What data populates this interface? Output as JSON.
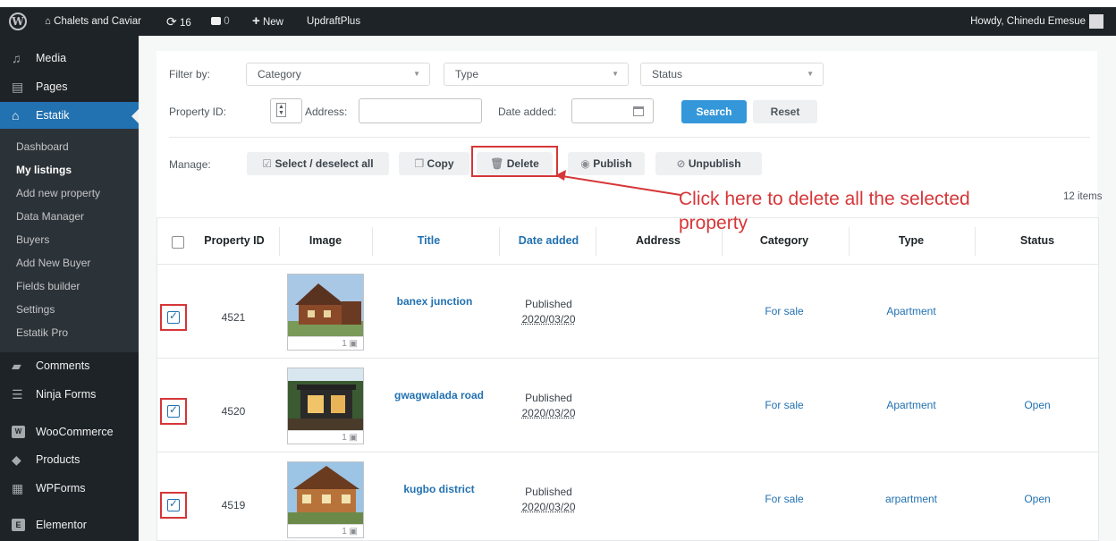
{
  "admin_bar": {
    "site_name": "Chalets and Caviar",
    "updates_count": "16",
    "comments_count": "0",
    "new_label": "New",
    "plugin_label": "UpdraftPlus",
    "howdy": "Howdy, Chinedu Emesue"
  },
  "sidebar": {
    "media": "Media",
    "pages": "Pages",
    "estatik": "Estatik",
    "submenu": [
      "Dashboard",
      "My listings",
      "Add new property",
      "Data Manager",
      "Buyers",
      "Add New Buyer",
      "Fields builder",
      "Settings",
      "Estatik Pro"
    ],
    "comments": "Comments",
    "ninja_forms": "Ninja Forms",
    "woocommerce": "WooCommerce",
    "products": "Products",
    "wpforms": "WPForms",
    "elementor": "Elementor"
  },
  "filter": {
    "filter_by_label": "Filter by:",
    "category_placeholder": "Category",
    "type_placeholder": "Type",
    "status_placeholder": "Status",
    "property_id_label": "Property ID:",
    "address_label": "Address:",
    "date_added_label": "Date added:",
    "search_button": "Search",
    "reset_button": "Reset"
  },
  "manage": {
    "label": "Manage:",
    "select_all": "Select / deselect all",
    "copy": "Copy",
    "delete": "Delete",
    "publish": "Publish",
    "unpublish": "Unpublish"
  },
  "items_count": "12 items",
  "annotation": {
    "line1": "Click here to delete all the selected",
    "line2": "property"
  },
  "table": {
    "headers": [
      "Property ID",
      "Image",
      "Title",
      "Date added",
      "Address",
      "Category",
      "Type",
      "Status"
    ],
    "rows": [
      {
        "id": "4521",
        "image_count": "1",
        "title": "banex junction",
        "status_text": "Published",
        "date": "2020/03/20",
        "address": "",
        "category": "For sale",
        "type": "Apartment",
        "status": ""
      },
      {
        "id": "4520",
        "image_count": "1",
        "title": "gwagwalada road",
        "status_text": "Published",
        "date": "2020/03/20",
        "address": "",
        "category": "For sale",
        "type": "Apartment",
        "status": "Open"
      },
      {
        "id": "4519",
        "image_count": "1",
        "title": "kugbo district",
        "status_text": "Published",
        "date": "2020/03/20",
        "address": "",
        "category": "For sale",
        "type": "arpartment",
        "status": "Open"
      }
    ]
  },
  "colors": {
    "admin_dark": "#1d2327",
    "accent": "#2271b1",
    "search_button": "#3497d9",
    "annotation": "#d63638"
  }
}
